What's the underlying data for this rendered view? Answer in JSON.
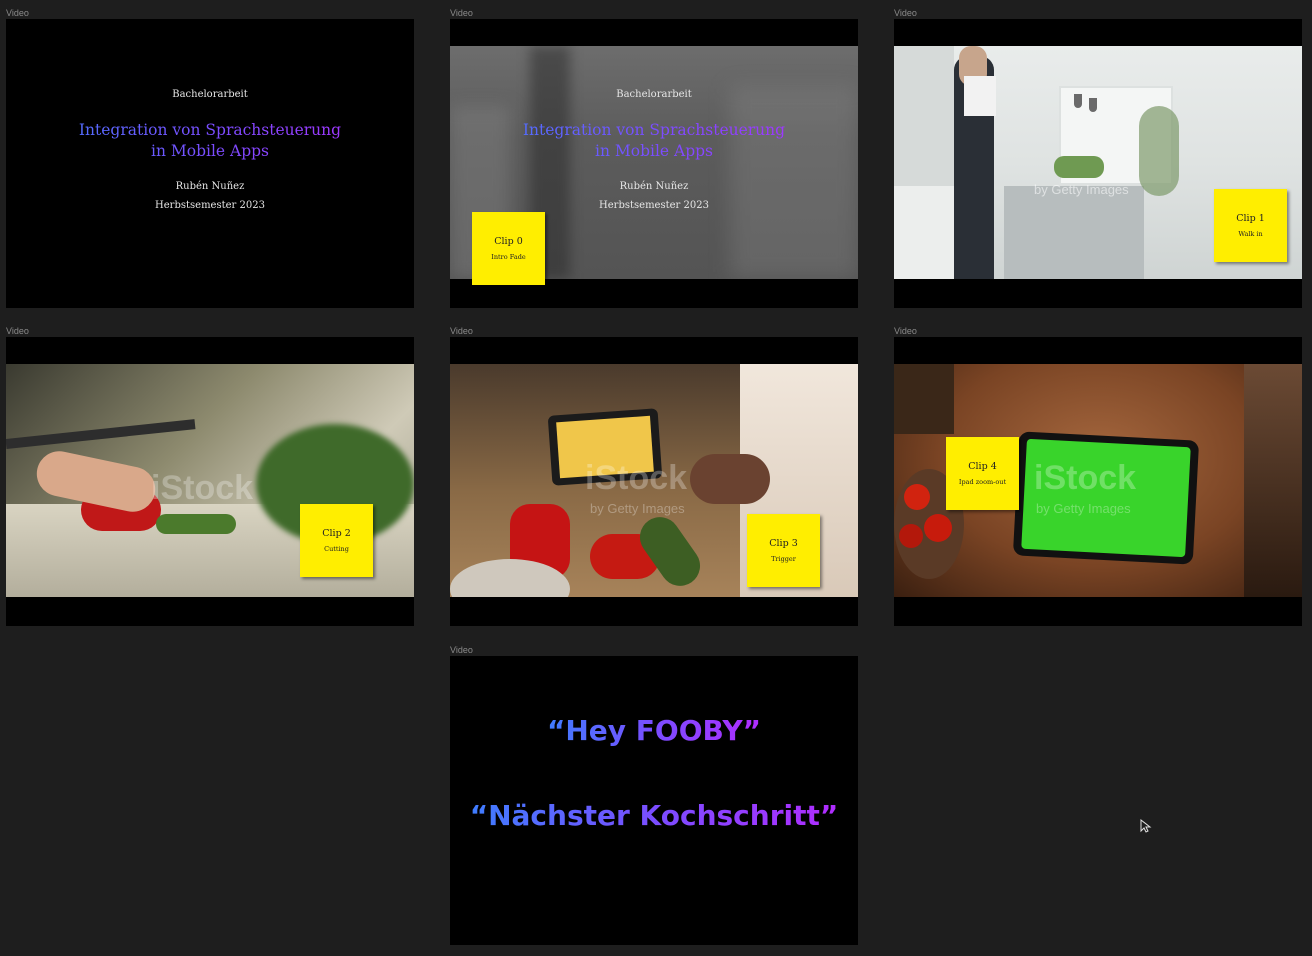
{
  "frames": [
    {
      "label": "Video"
    },
    {
      "label": "Video"
    },
    {
      "label": "Video"
    },
    {
      "label": "Video"
    },
    {
      "label": "Video"
    },
    {
      "label": "Video"
    },
    {
      "label": "Video"
    }
  ],
  "title_slide": {
    "kicker": "Bachelorarbeit",
    "title_line1": "Integration von Sprachsteuerung",
    "title_line2": "in Mobile Apps",
    "author": "Rubén Nuñez",
    "semester": "Herbstsemester 2023"
  },
  "stickies": [
    {
      "clip": "Clip 0",
      "desc": "Intro Fade"
    },
    {
      "clip": "Clip 1",
      "desc": "Walk in"
    },
    {
      "clip": "Clip 2",
      "desc": "Cutting"
    },
    {
      "clip": "Clip 3",
      "desc": "Trigger"
    },
    {
      "clip": "Clip 4",
      "desc": "Ipad zoom-out"
    }
  ],
  "watermarks": {
    "istock": "iStock",
    "getty": "by Getty Images"
  },
  "voice_slide": {
    "line1": "“Hey FOOBY”",
    "line2": "“Nächster Kochschritt”"
  },
  "colors": {
    "sticky": "#ffee00",
    "gradient_start": "#3f7dff",
    "gradient_end": "#b12cff",
    "canvas": "#1e1e1e"
  }
}
